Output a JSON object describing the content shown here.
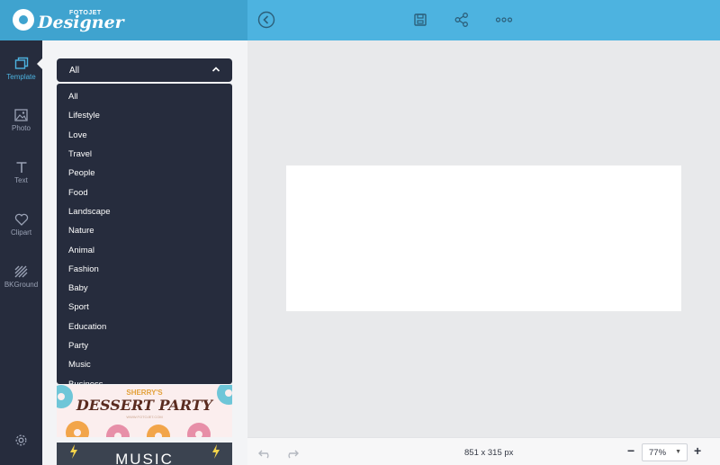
{
  "brand": {
    "top_text": "FOTOJET",
    "main_text": "Designer"
  },
  "sidebar": {
    "items": [
      {
        "label": "Template",
        "active": true
      },
      {
        "label": "Photo"
      },
      {
        "label": "Text"
      },
      {
        "label": "Clipart"
      },
      {
        "label": "BKGround"
      }
    ]
  },
  "template_panel": {
    "category_select": {
      "value": "All"
    },
    "options": [
      "All",
      "Lifestyle",
      "Love",
      "Travel",
      "People",
      "Food",
      "Landscape",
      "Nature",
      "Animal",
      "Fashion",
      "Baby",
      "Sport",
      "Education",
      "Party",
      "Music",
      "Business"
    ],
    "thumbnails": [
      {
        "subtitle": "SHERRY'S",
        "title": "DESSERT PARTY",
        "url": "WWW.FOTOJET.COM"
      },
      {
        "title": "MUSIC"
      }
    ]
  },
  "status": {
    "canvas_size": "851 x 315 px",
    "zoom": "77%"
  },
  "colors": {
    "accent": "#4db3e0",
    "dark": "#262c3d"
  }
}
